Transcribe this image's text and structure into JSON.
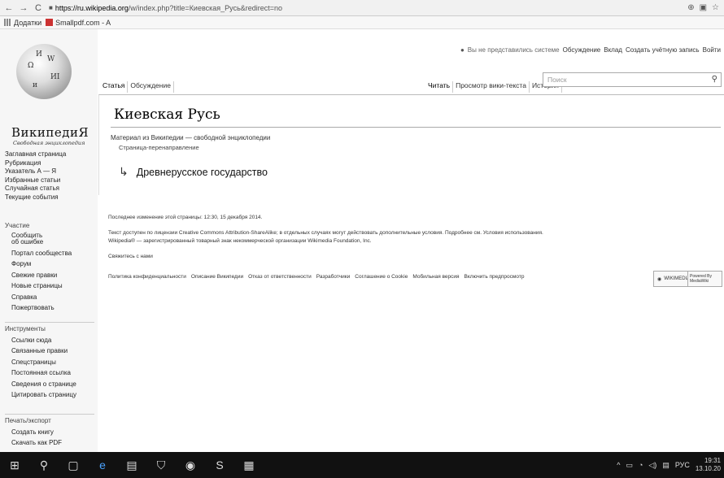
{
  "browser": {
    "url_host": "https://ru.wikipedia.org",
    "url_path": "/w/index.php?title=Киевская_Русь&redirect=no",
    "bookmarks": [
      "Додатки",
      "Smallpdf.com - A"
    ]
  },
  "site": {
    "wordmark": "ВикипедиЯ",
    "tagline": "Свободная энциклопедия",
    "globe_glyphs": [
      "Ω",
      "W",
      "И",
      "ИІ",
      "и"
    ]
  },
  "personal": {
    "not_logged": "Вы не представились системе",
    "links": [
      "Обсуждение",
      "Вклад",
      "Создать учётную запись",
      "Войти"
    ]
  },
  "tabs_left": [
    "Статья",
    "Обсуждение"
  ],
  "tabs_right": [
    "Читать",
    "Просмотр вики-текста",
    "История"
  ],
  "search": {
    "placeholder": "Поиск"
  },
  "sidebar": {
    "nav": [
      "Заглавная страница",
      "Рубрикация",
      "Указатель А — Я",
      "Избранные статьи",
      "Случайная статья",
      "Текущие события"
    ],
    "participation_heading": "Участие",
    "participation": [
      "Сообщить",
      "об ошибке",
      "Портал сообщества",
      "Форум",
      "Свежие правки",
      "Новые страницы",
      "Справка",
      "Пожертвовать"
    ],
    "tools_heading": "Инструменты",
    "tools": [
      "Ссылки сюда",
      "Связанные правки",
      "Спецстраницы",
      "Постоянная ссылка",
      "Сведения о странице",
      "Цитировать страницу"
    ],
    "print_heading": "Печать/экспорт",
    "print": [
      "Создать книгу",
      "Скачать как PDF"
    ]
  },
  "article": {
    "title": "Киевская Русь",
    "from": "Материал из Википедии — свободной энциклопедии",
    "redirect_note": "Страница-перенаправление",
    "redirect_target": "Древнерусское государство"
  },
  "footer": {
    "last_modified": "Последнее изменение этой страницы: 12:30, 15 декабря 2014.",
    "license_1": "Текст доступен по лицензии Creative Commons Attribution-ShareAlike; в отдельных случаях могут действовать дополнительные условия. Подробнее см. Условия использования.",
    "license_2": "Wikipedia® — зарегистрированный товарный знак некоммерческой организации Wikimedia Foundation, Inc.",
    "contact": "Свяжитесь с нами",
    "links": [
      "Политика конфиденциальности",
      "Описание Википедии",
      "Отказ от ответственности",
      "Разработчики",
      "Соглашение о Cookie",
      "Мобильная версия",
      "Включить предпросмотр"
    ],
    "badge_wikimedia": "WIKIMEDIA project",
    "badge_mediawiki": "Powered By MediaWiki"
  },
  "taskbar": {
    "lang": "РУС",
    "time": "19:31",
    "date": "13.10.20"
  }
}
